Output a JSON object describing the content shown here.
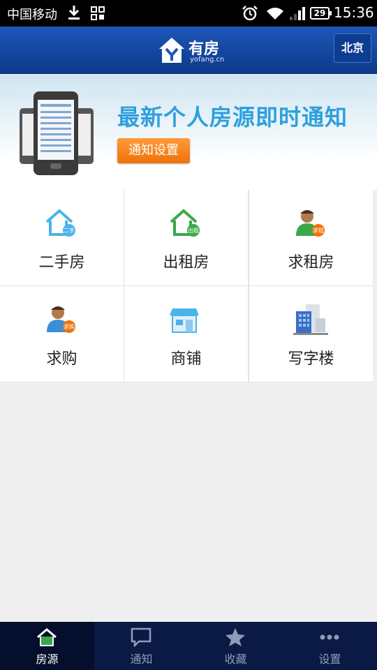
{
  "status_bar": {
    "carrier": "中国移动",
    "battery": "29",
    "time": "15:36"
  },
  "header": {
    "brand": "有房",
    "domain": "yofang.cn",
    "city": "北京"
  },
  "banner": {
    "headline": "最新个人房源即时通知",
    "button": "通知设置"
  },
  "categories": [
    {
      "label": "二手房",
      "badge": "二手"
    },
    {
      "label": "出租房",
      "badge": "出租"
    },
    {
      "label": "求租房",
      "badge": "求租"
    },
    {
      "label": "求购",
      "badge": "求购"
    },
    {
      "label": "商铺"
    },
    {
      "label": "写字楼"
    }
  ],
  "tabs": [
    {
      "label": "房源",
      "icon": "home-icon",
      "active": true
    },
    {
      "label": "通知",
      "icon": "chat-icon",
      "active": false
    },
    {
      "label": "收藏",
      "icon": "star-icon",
      "active": false
    },
    {
      "label": "设置",
      "icon": "more-icon",
      "active": false
    }
  ],
  "colors": {
    "header": "#1e56b8",
    "headline": "#2da0dd",
    "button": "#f07208",
    "tabbar": "#0a1a45"
  }
}
